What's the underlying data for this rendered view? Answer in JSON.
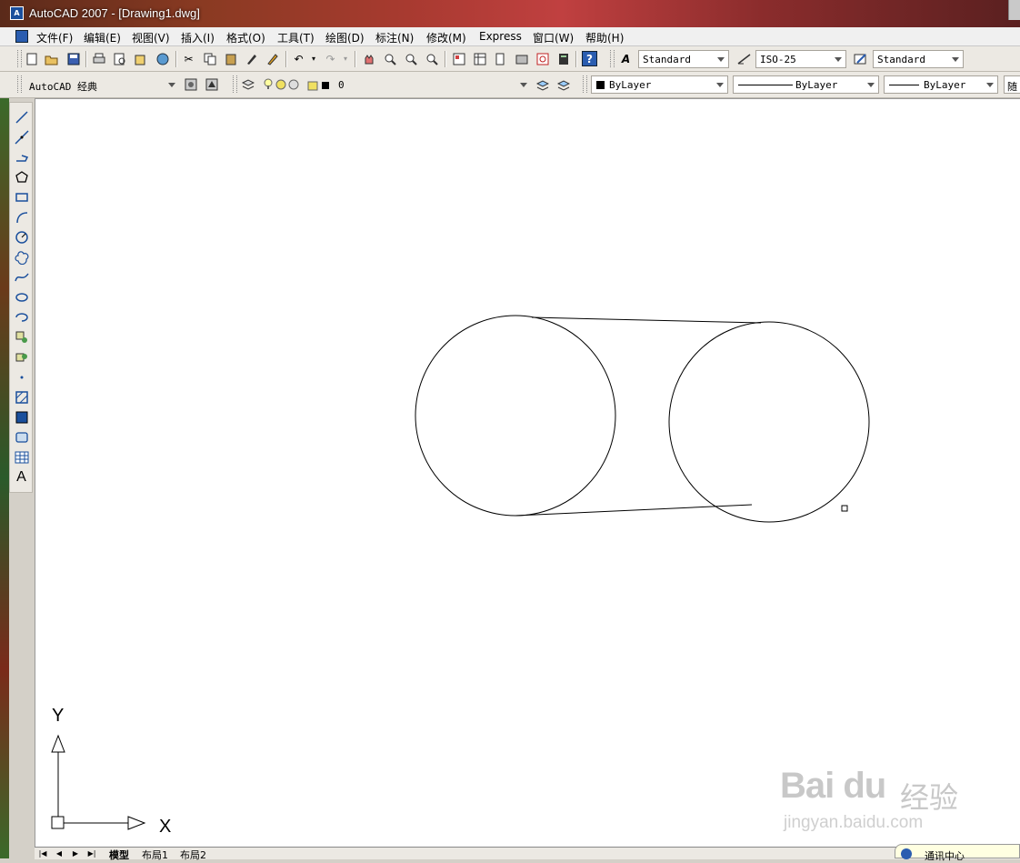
{
  "window": {
    "title": "AutoCAD 2007 - [Drawing1.dwg]",
    "app_icon_glyph": "A"
  },
  "menu": [
    {
      "label": "文件(F)"
    },
    {
      "label": "编辑(E)"
    },
    {
      "label": "视图(V)"
    },
    {
      "label": "插入(I)"
    },
    {
      "label": "格式(O)"
    },
    {
      "label": "工具(T)"
    },
    {
      "label": "绘图(D)"
    },
    {
      "label": "标注(N)"
    },
    {
      "label": "修改(M)"
    },
    {
      "label": "Express"
    },
    {
      "label": "窗口(W)"
    },
    {
      "label": "帮助(H)"
    }
  ],
  "styles_toolbar": {
    "text_style": "Standard",
    "dim_style": "ISO-25",
    "table_style": "Standard"
  },
  "workspace_toolbar": {
    "workspace": "AutoCAD 经典"
  },
  "layers_toolbar": {
    "current_layer": "0"
  },
  "properties_toolbar": {
    "color": "ByLayer",
    "linetype": "ByLayer",
    "lineweight": "ByLayer",
    "overflow_glyph": "随"
  },
  "draw_toolbar": {
    "text_tool_glyph": "A"
  },
  "ucs_icon": {
    "x_label": "X",
    "y_label": "Y"
  },
  "layout_tabs": [
    {
      "label": "模型"
    },
    {
      "label": "布局1"
    },
    {
      "label": "布局2"
    }
  ],
  "tab_nav": [
    "|◀",
    "◀",
    "▶",
    "▶|"
  ],
  "watermark": {
    "brand": "Bai du",
    "brand_cn": "经验",
    "url": "jingyan.baidu.com"
  },
  "notification": {
    "text": "通讯中心"
  },
  "colors": {
    "canvas_bg": "#ffffff",
    "toolbar_bg": "#ece9e3",
    "stroke": "#000000"
  }
}
